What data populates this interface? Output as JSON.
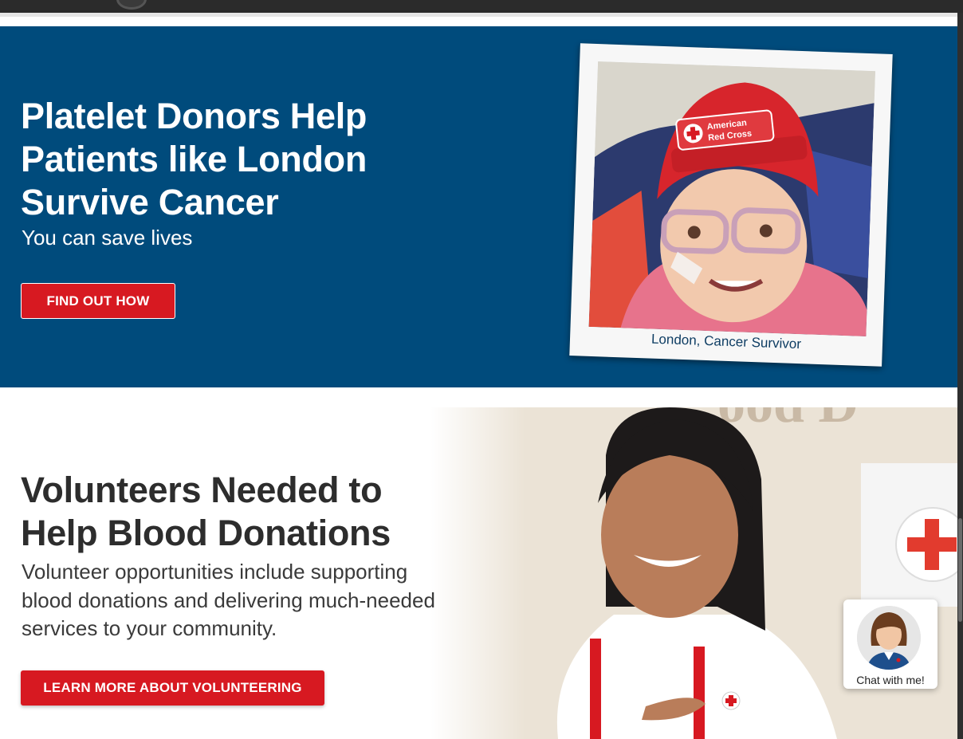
{
  "hero": {
    "title": "Platelet Donors Help Patients like London Survive Cancer",
    "subtitle": "You can save lives",
    "button_label": "FIND OUT HOW",
    "photo_caption": "London, Cancer Survivor",
    "hat_text_line1": "American",
    "hat_text_line2": "Red Cross",
    "background_color": "#004b7c"
  },
  "volunteer": {
    "title": "Volunteers Needed to Help Blood Donations",
    "body": "Volunteer opportunities include supporting blood donations and delivering much-needed services to your community.",
    "button_label": "LEARN MORE ABOUT VOLUNTEERING"
  },
  "chat": {
    "label": "Chat with me!"
  },
  "colors": {
    "brand_red": "#d71921",
    "brand_blue": "#004b7c"
  },
  "icons": [
    "red-cross-logo-icon",
    "chat-avatar-icon"
  ]
}
